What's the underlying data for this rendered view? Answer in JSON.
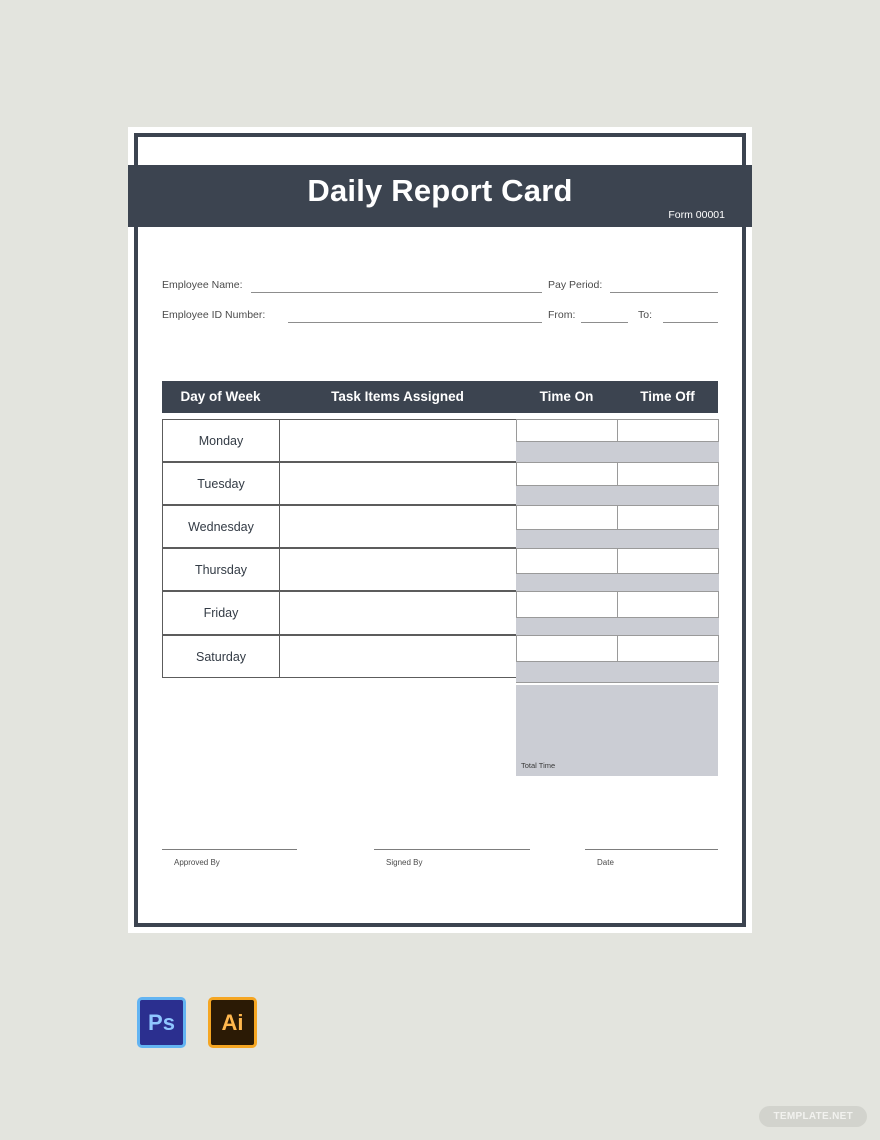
{
  "document": {
    "title": "Daily Report Card",
    "form_number": "Form 00001"
  },
  "meta_fields": {
    "employee_name_label": "Employee Name:",
    "pay_period_label": "Pay Period:",
    "employee_id_label": "Employee ID Number:",
    "from_label": "From:",
    "to_label": "To:",
    "employee_name_value": "",
    "pay_period_value": "",
    "employee_id_value": "",
    "from_value": "",
    "to_value": ""
  },
  "table": {
    "columns": [
      "Day of Week",
      "Task Items Assigned",
      "Time On",
      "Time Off"
    ],
    "rows": [
      {
        "day": "Monday",
        "task": "",
        "time_on": "",
        "time_off": ""
      },
      {
        "day": "Tuesday",
        "task": "",
        "time_on": "",
        "time_off": ""
      },
      {
        "day": "Wednesday",
        "task": "",
        "time_on": "",
        "time_off": ""
      },
      {
        "day": "Thursday",
        "task": "",
        "time_on": "",
        "time_off": ""
      },
      {
        "day": "Friday",
        "task": "",
        "time_on": "",
        "time_off": ""
      },
      {
        "day": "Saturday",
        "task": "",
        "time_on": "",
        "time_off": ""
      }
    ],
    "total_time_label": "Total Time",
    "total_time_value": ""
  },
  "signatures": {
    "approved_by_label": "Approved By",
    "signed_by_label": "Signed By",
    "date_label": "Date"
  },
  "app_icons": [
    {
      "name": "photoshop-icon",
      "glyph": "Ps"
    },
    {
      "name": "illustrator-icon",
      "glyph": "Ai"
    }
  ],
  "watermark": {
    "text": "TEMPLATE.NET"
  },
  "colors": {
    "background": "#e3e4de",
    "header_dark": "#3c4450",
    "band_gray": "#cbcdd4",
    "sheet_white": "#ffffff"
  }
}
